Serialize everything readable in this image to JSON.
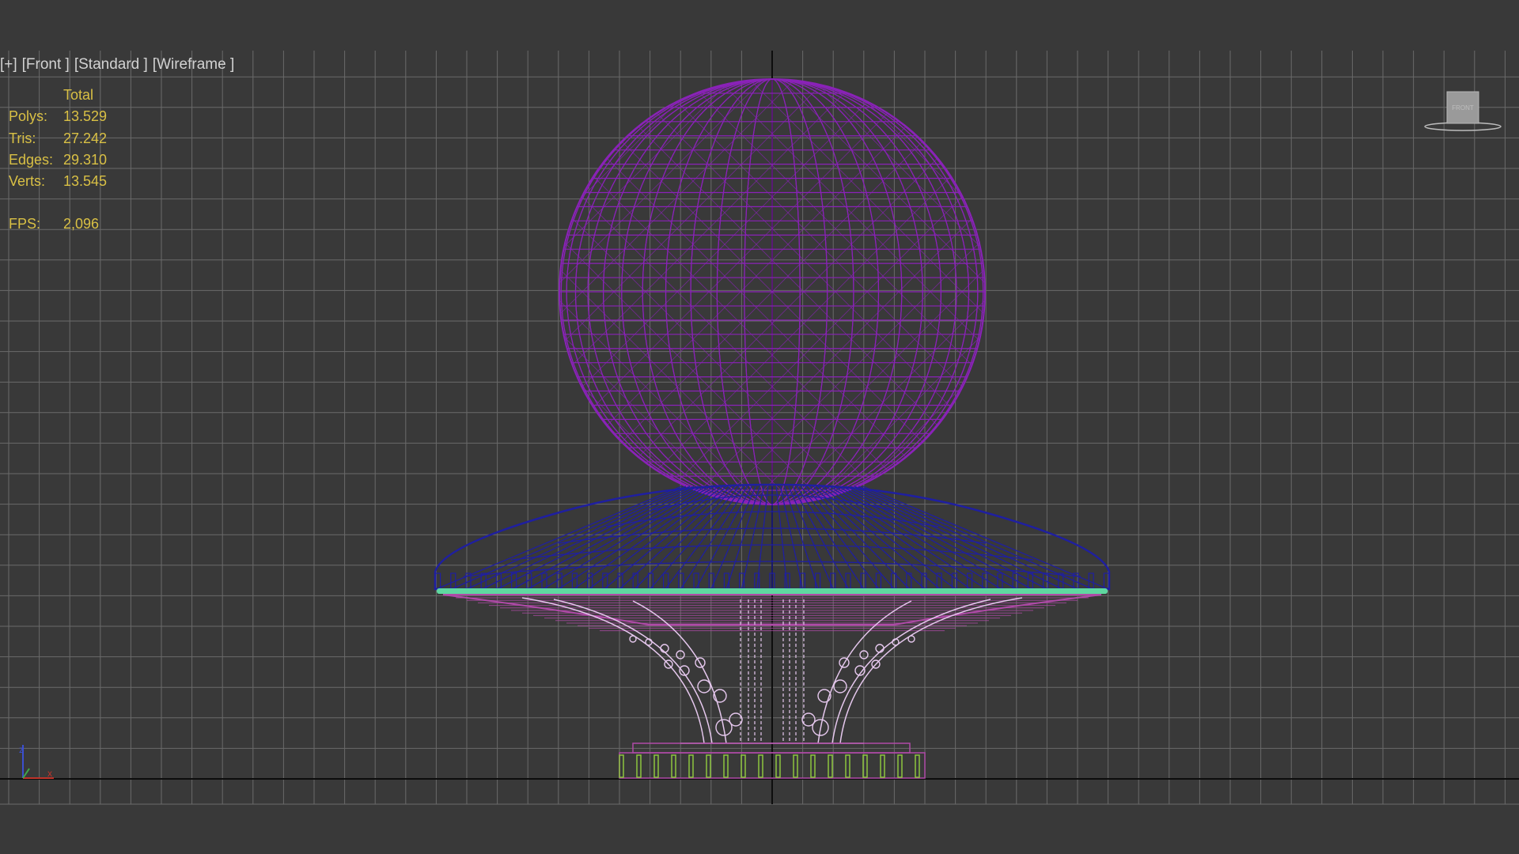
{
  "viewport": {
    "labels": [
      "[+]",
      "[Front ]",
      "[Standard ]",
      "[Wireframe ]"
    ]
  },
  "stats": {
    "header": "Total",
    "polys_label": "Polys:",
    "polys_value": "13.529",
    "tris_label": "Tris:",
    "tris_value": "27.242",
    "edges_label": "Edges:",
    "edges_value": "29.310",
    "verts_label": "Verts:",
    "verts_value": "13.545",
    "fps_label": "FPS:",
    "fps_value": "2,096"
  },
  "viewcube": {
    "face_label": "FRONT"
  },
  "colors": {
    "background": "#393939",
    "grid": "#6a6a6a",
    "axis": "#0d0d0d",
    "stats_text": "#d9c045",
    "label_text": "#d2d2d2",
    "sphere": "#8a22b8",
    "dome": "#1f1fa0",
    "rim": "#5fd8a0",
    "underside": "#b04aa8",
    "stem": "#e6c8ee",
    "base": "#8ec63f"
  }
}
